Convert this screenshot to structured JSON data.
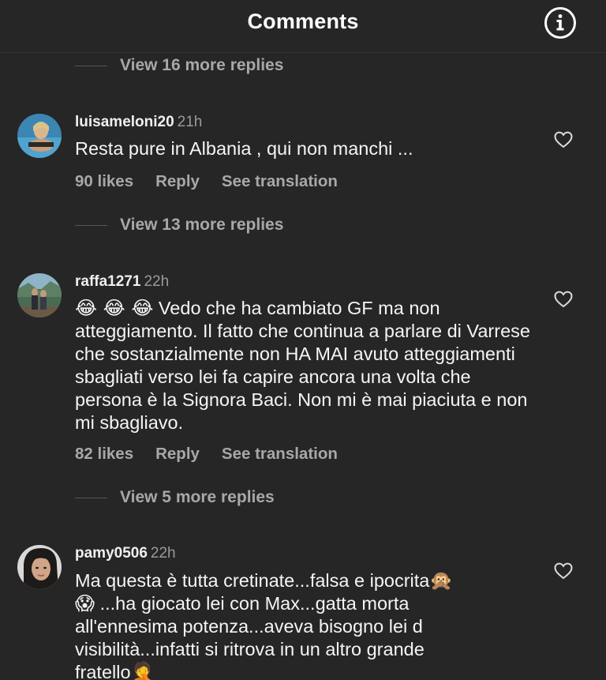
{
  "header": {
    "title": "Comments",
    "info_icon": "info-circle-icon"
  },
  "threads": [
    {
      "view_more": "View 16 more replies"
    }
  ],
  "comments": [
    {
      "username": "luisameloni20",
      "time": "21h",
      "text": "Resta pure in Albania , qui non manchi ...",
      "likes": "90 likes",
      "reply": "Reply",
      "translate": "See translation",
      "view_more": "View 13 more replies"
    },
    {
      "username": "raffa1271",
      "time": "22h",
      "emoji_prefix": "😂 😂 😂",
      "text": "Vedo che ha cambiato GF ma non atteggiamento. Il fatto che continua a parlare di Varrese  che sostanzialmente non HA MAI avuto atteggiamenti sbagliati verso lei fa capire ancora una volta che persona è la Signora Baci. Non mi è mai piaciuta e non mi sbagliavo.",
      "likes": "82 likes",
      "reply": "Reply",
      "translate": "See translation",
      "view_more": "View 5 more replies"
    },
    {
      "username": "pamy0506",
      "time": "22h",
      "text_line1": "Ma questa è  tutta cretinate...falsa e ipocrita",
      "emoji_a": "🙊",
      "emoji_b": "😱",
      "text_line2": "...ha giocato lei con Max...gatta morta",
      "text_rest": "all'ennesima potenza...aveva bisogno lei d visibilità...infatti si ritrova in un altro grande",
      "text_cut": "fratello",
      "emoji_c": "🤦"
    }
  ],
  "colors": {
    "background": "#262626",
    "text": "#f5f5f5",
    "muted": "#a8a8a8"
  }
}
